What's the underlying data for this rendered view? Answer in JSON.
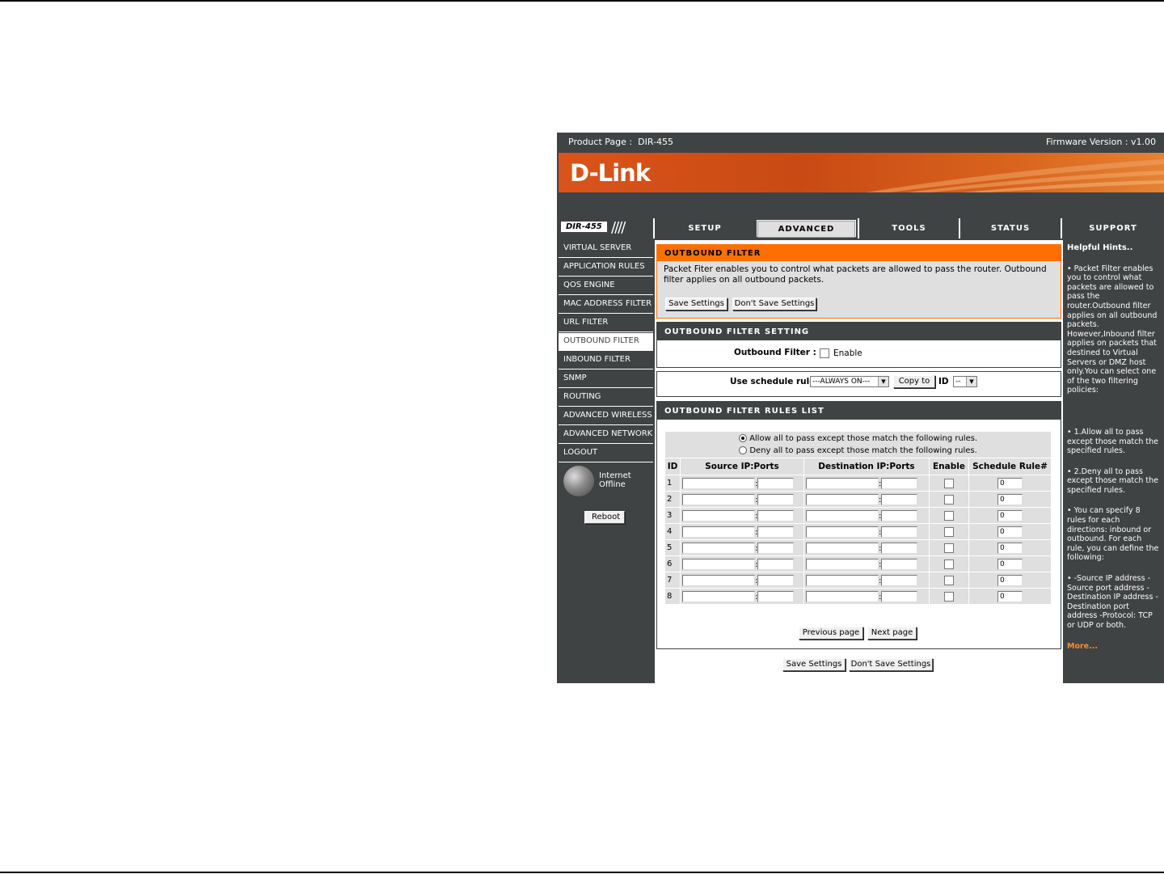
{
  "header": {
    "product_label": "Product Page :",
    "product_value": "DIR-455",
    "firmware_label": "Firmware Version : v1.00",
    "logo": "D-Link",
    "model": "DIR-455"
  },
  "tabs": [
    {
      "label": "SETUP",
      "active": false
    },
    {
      "label": "ADVANCED",
      "active": true
    },
    {
      "label": "TOOLS",
      "active": false
    },
    {
      "label": "STATUS",
      "active": false
    },
    {
      "label": "SUPPORT",
      "active": false
    }
  ],
  "sidebar": {
    "items": [
      {
        "label": "VIRTUAL SERVER",
        "active": false
      },
      {
        "label": "APPLICATION RULES",
        "active": false
      },
      {
        "label": "QOS ENGINE",
        "active": false
      },
      {
        "label": "MAC ADDRESS FILTER",
        "active": false
      },
      {
        "label": "URL FILTER",
        "active": false
      },
      {
        "label": "OUTBOUND FILTER",
        "active": true
      },
      {
        "label": "INBOUND FILTER",
        "active": false
      },
      {
        "label": "SNMP",
        "active": false
      },
      {
        "label": "ROUTING",
        "active": false
      },
      {
        "label": "ADVANCED WIRELESS",
        "active": false
      },
      {
        "label": "ADVANCED NETWORK",
        "active": false
      },
      {
        "label": "LOGOUT",
        "active": false
      }
    ],
    "status_line1": "Internet",
    "status_line2": "Offline",
    "reboot_label": "Reboot"
  },
  "intro": {
    "title": "OUTBOUND FILTER",
    "text": "Packet Fiter enables you to control what packets are allowed to pass the router. Outbound filter applies on all outbound packets.",
    "save_label": "Save Settings",
    "dont_save_label": "Don't Save Settings"
  },
  "setting": {
    "title": "OUTBOUND FILTER SETTING",
    "field_label": "Outbound Filter :",
    "enable_label": "Enable"
  },
  "schedule": {
    "label": "Use schedule rule",
    "selected": "---ALWAYS ON---",
    "copy_label": "Copy to",
    "id_label": "ID",
    "id_selected": "--"
  },
  "rules": {
    "title": "OUTBOUND FILTER RULES LIST",
    "policy_allow": "Allow all to pass except those match the following rules.",
    "policy_deny": "Deny all to pass except those match the following rules.",
    "columns": [
      "ID",
      "Source IP:Ports",
      "Destination IP:Ports",
      "Enable",
      "Schedule Rule#"
    ],
    "rows": [
      {
        "id": "1",
        "schedule": "0"
      },
      {
        "id": "2",
        "schedule": "0"
      },
      {
        "id": "3",
        "schedule": "0"
      },
      {
        "id": "4",
        "schedule": "0"
      },
      {
        "id": "5",
        "schedule": "0"
      },
      {
        "id": "6",
        "schedule": "0"
      },
      {
        "id": "7",
        "schedule": "0"
      },
      {
        "id": "8",
        "schedule": "0"
      }
    ],
    "prev_label": "Previous page",
    "next_label": "Next page"
  },
  "footer": {
    "save_label": "Save Settings",
    "dont_save_label": "Don't Save Settings"
  },
  "hints": {
    "title": "Helpful Hints..",
    "p1": "• Packet Filter enables you to control what packets are allowed to pass the router.Outbound filter applies on all outbound packets. However,Inbound filter applies on packets that destined to Virtual Servers or DMZ host only.You can select one of the two filtering policies:",
    "p2": "• 1.Allow all to pass except those match the specified rules.",
    "p3": "• 2.Deny all to pass except those match the specified rules.",
    "p4": "• You can specify 8 rules for each directions: inbound or outbound. For each rule, you can define the following:",
    "p5": "• -Source IP address -Source port address -Destination IP address -Destination port address -Protocol: TCP or UDP or both.",
    "more": "More..."
  }
}
